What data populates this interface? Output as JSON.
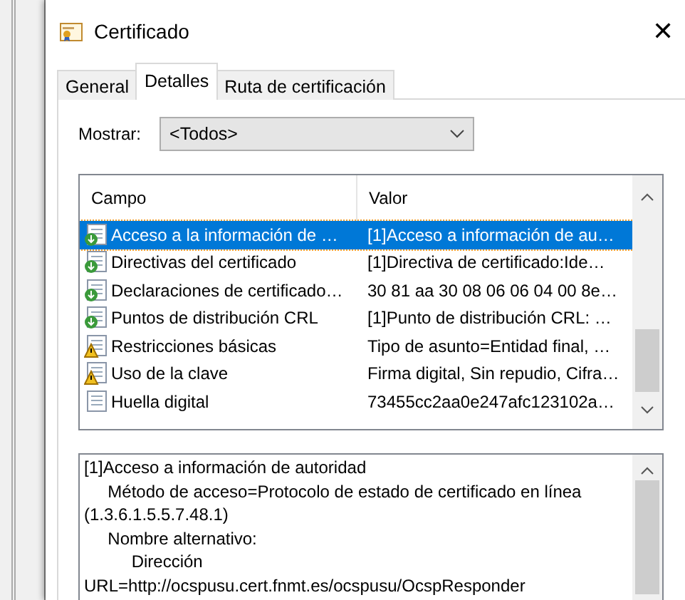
{
  "window": {
    "title": "Certificado",
    "close": "✕"
  },
  "tabs": [
    {
      "label": "General",
      "selected": false
    },
    {
      "label": "Detalles",
      "selected": true
    },
    {
      "label": "Ruta de certificación",
      "selected": false
    }
  ],
  "show": {
    "label": "Mostrar:",
    "value": "<Todos>"
  },
  "fields_table": {
    "columns": [
      "Campo",
      "Valor"
    ],
    "rows": [
      {
        "kind": "extension",
        "field": "Acceso a la información de …",
        "value": "[1]Acceso a información de au…",
        "selected": true
      },
      {
        "kind": "extension",
        "field": "Directivas del certificado",
        "value": "[1]Directiva de certificado:Ide…",
        "selected": false
      },
      {
        "kind": "extension",
        "field": "Declaraciones de certificado…",
        "value": "30 81 aa 30 08 06 06 04 00 8e…",
        "selected": false
      },
      {
        "kind": "extension",
        "field": "Puntos de distribución CRL",
        "value": "[1]Punto de distribución CRL: …",
        "selected": false
      },
      {
        "kind": "critical",
        "field": "Restricciones básicas",
        "value": "Tipo de asunto=Entidad final, …",
        "selected": false
      },
      {
        "kind": "critical",
        "field": "Uso de la clave",
        "value": "Firma digital, Sin repudio, Cifra…",
        "selected": false
      },
      {
        "kind": "property",
        "field": "Huella digital",
        "value": "73455cc2aa0e247afc123102a…",
        "selected": false
      }
    ]
  },
  "details": {
    "text": "[1]Acceso a información de autoridad\n     Método de acceso=Protocolo de estado de certificado en línea\n(1.3.6.1.5.5.7.48.1)\n     Nombre alternativo:\n          Dirección\nURL=http://ocspusu.cert.fnmt.es/ocspusu/OcspResponder"
  }
}
